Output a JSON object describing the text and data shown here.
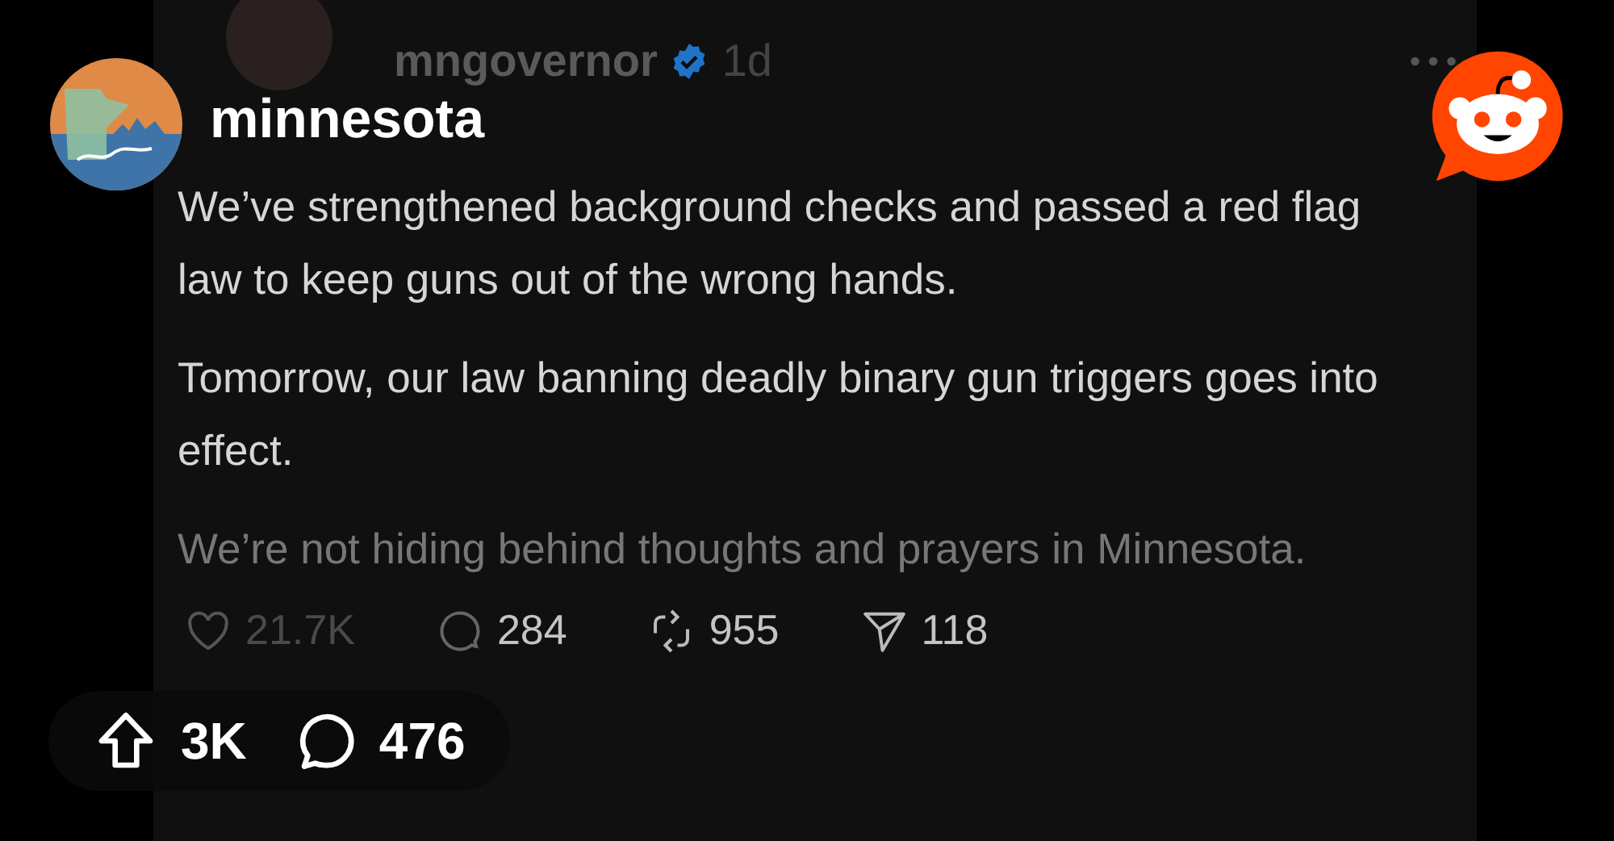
{
  "overlay": {
    "subreddit": "minnesota",
    "upvotes": "3K",
    "comments": "476"
  },
  "post": {
    "author": "mngovernor",
    "verified": true,
    "age": "1d",
    "paragraphs": [
      "We’ve strengthened background checks and passed a red flag law to keep guns out of the wrong hands.",
      "Tomorrow, our law banning deadly binary gun triggers goes into effect.",
      "We’re not hiding behind thoughts and prayers in Minnesota."
    ],
    "actions": [
      {
        "kind": "like",
        "count": "21.7K"
      },
      {
        "kind": "reply",
        "count": "284"
      },
      {
        "kind": "repost",
        "count": "955"
      },
      {
        "kind": "share",
        "count": "118"
      }
    ]
  }
}
